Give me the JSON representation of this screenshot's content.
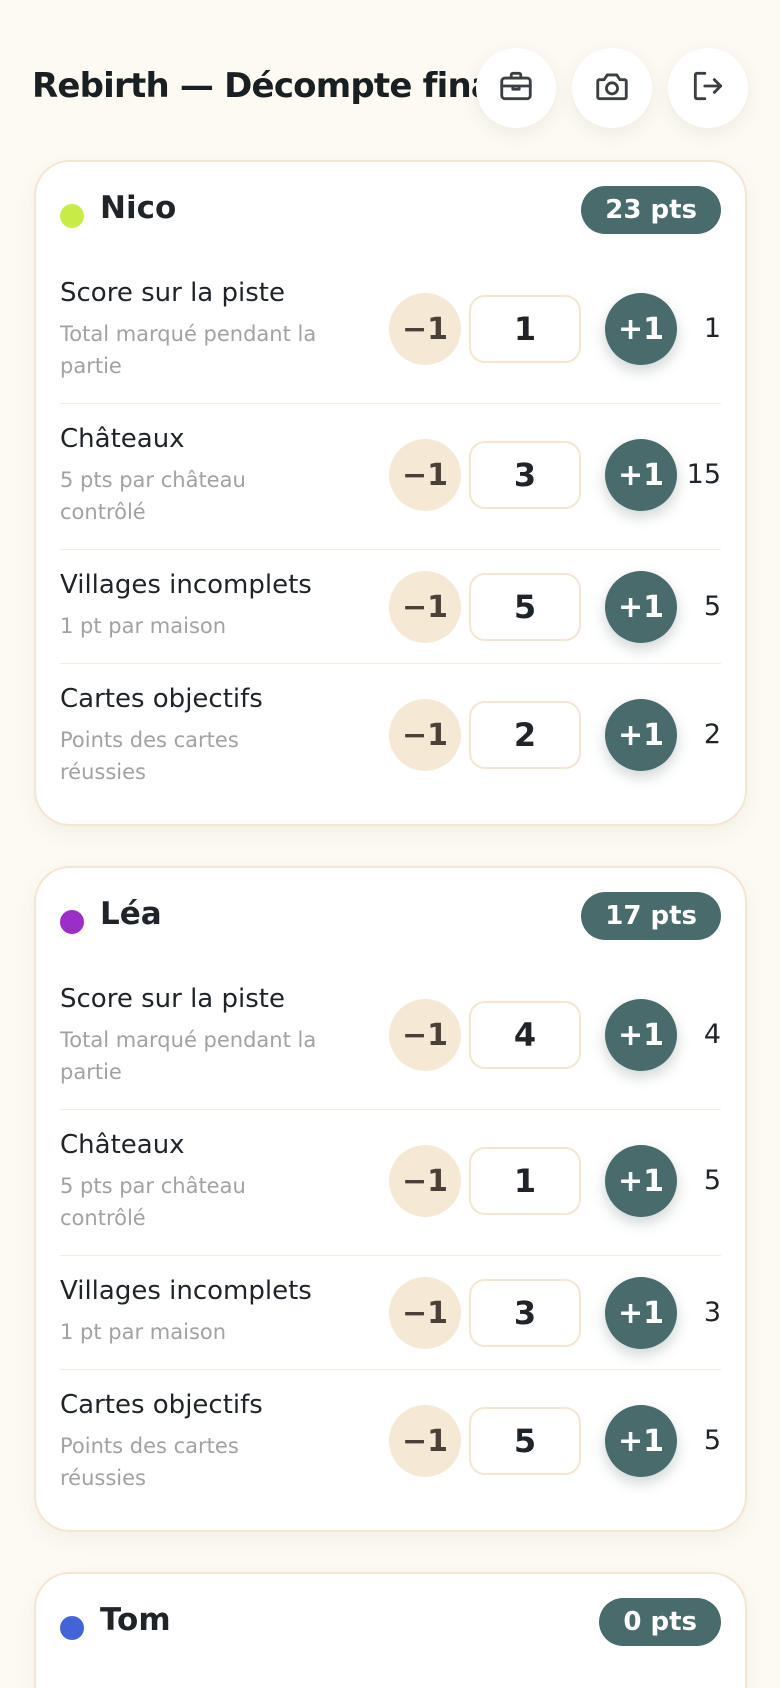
{
  "header": {
    "title": "Rebirth — Décompte final",
    "buttons": [
      {
        "icon": "briefcase-icon"
      },
      {
        "icon": "camera-icon"
      },
      {
        "icon": "logout-icon"
      }
    ]
  },
  "players": [
    {
      "name": "Nico",
      "color": "#c7ec45",
      "points": "23 pts",
      "rows": [
        {
          "label": "Score sur la piste",
          "sub": "Total marqué pendant la partie",
          "minus": "−1",
          "value": "1",
          "plus": "+1",
          "total": "1"
        },
        {
          "label": "Châteaux",
          "sub": "5 pts par château contrôlé",
          "minus": "−1",
          "value": "3",
          "plus": "+1",
          "total": "15"
        },
        {
          "label": "Villages incomplets",
          "sub": "1 pt par maison",
          "minus": "−1",
          "value": "5",
          "plus": "+1",
          "total": "5"
        },
        {
          "label": "Cartes objectifs",
          "sub": "Points des cartes réussies",
          "minus": "−1",
          "value": "2",
          "plus": "+1",
          "total": "2"
        }
      ]
    },
    {
      "name": "Léa",
      "color": "#9a2ec6",
      "points": "17 pts",
      "rows": [
        {
          "label": "Score sur la piste",
          "sub": "Total marqué pendant la partie",
          "minus": "−1",
          "value": "4",
          "plus": "+1",
          "total": "4"
        },
        {
          "label": "Châteaux",
          "sub": "5 pts par château contrôlé",
          "minus": "−1",
          "value": "1",
          "plus": "+1",
          "total": "5"
        },
        {
          "label": "Villages incomplets",
          "sub": "1 pt par maison",
          "minus": "−1",
          "value": "3",
          "plus": "+1",
          "total": "3"
        },
        {
          "label": "Cartes objectifs",
          "sub": "Points des cartes réussies",
          "minus": "−1",
          "value": "5",
          "plus": "+1",
          "total": "5"
        }
      ]
    },
    {
      "name": "Tom",
      "color": "#4264d6",
      "points": "0 pts"
    }
  ]
}
